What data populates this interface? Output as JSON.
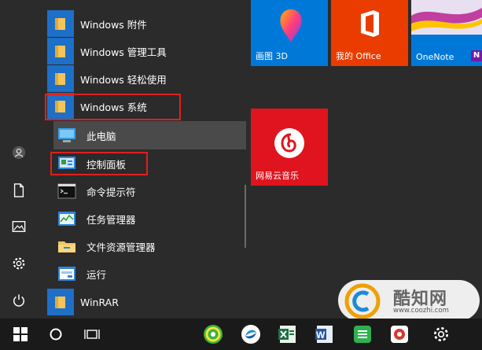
{
  "applist": {
    "items": [
      {
        "label": "Windows 附件",
        "type": "folder"
      },
      {
        "label": "Windows 管理工具",
        "type": "folder"
      },
      {
        "label": "Windows 轻松使用",
        "type": "folder"
      },
      {
        "label": "Windows 系统",
        "type": "folder",
        "expanded": true
      },
      {
        "label": "此电脑",
        "type": "app"
      },
      {
        "label": "控制面板",
        "type": "app"
      },
      {
        "label": "命令提示符",
        "type": "app"
      },
      {
        "label": "任务管理器",
        "type": "app"
      },
      {
        "label": "文件资源管理器",
        "type": "app"
      },
      {
        "label": "运行",
        "type": "app"
      },
      {
        "label": "WinRAR",
        "type": "folder"
      }
    ]
  },
  "tiles": [
    {
      "label": "画图 3D",
      "color": "#0078d7"
    },
    {
      "label": "我的 Office",
      "color": "#eb3c00"
    },
    {
      "label": "OneNote",
      "color": "#0078d7"
    },
    {
      "label": "网易云音乐",
      "color": "#e0141e"
    }
  ],
  "rail": {
    "icons": [
      "user-icon",
      "document-icon",
      "picture-icon",
      "settings-icon",
      "power-icon"
    ]
  },
  "taskbar": {
    "icons": [
      "windows-start-icon",
      "cortana-icon",
      "task-view-icon",
      "360-browser-icon",
      "sogou-browser-icon",
      "excel-icon",
      "word-icon",
      "wps-table-icon",
      "taskbar-app-icon",
      "settings-icon"
    ]
  },
  "watermark": {
    "name": "酷知网",
    "url": "www.coozhi.com"
  },
  "colors": {
    "accent": "#1e6fc8",
    "highlight": "#e02020",
    "background": "#2b2b2b"
  }
}
